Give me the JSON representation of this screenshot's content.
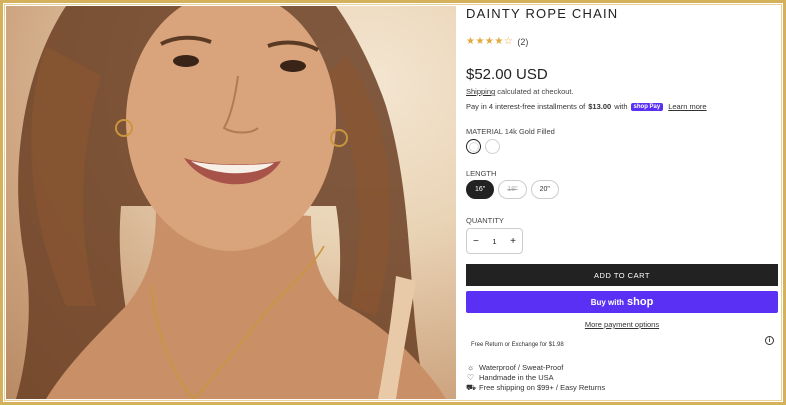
{
  "product": {
    "title": "DAINTY ROPE CHAIN",
    "stars": "★★★★☆",
    "review_count": "(2)",
    "rating": 4,
    "price": "$52.00 USD",
    "shipping_link": "Shipping",
    "shipping_text": "calculated at checkout.",
    "install_pre": "Pay in 4 interest-free installments of",
    "install_amount": "$13.00",
    "install_with": "with",
    "shoppay_badge": "shop Pay",
    "learn_more": "Learn more"
  },
  "material": {
    "label": "MATERIAL",
    "value": "14k Gold Filled"
  },
  "length": {
    "label": "LENGTH",
    "options": [
      "16\"",
      "18\"",
      "20\""
    ]
  },
  "quantity": {
    "label": "QUANTITY",
    "value": "1",
    "minus": "−",
    "plus": "+"
  },
  "actions": {
    "add_to_cart": "ADD TO CART",
    "buy_with": "Buy with",
    "shop": "shop",
    "more_payment": "More payment options"
  },
  "free_return": "Free Return or Exchange for $1.98",
  "info_icon": "i",
  "features": [
    {
      "icon": "sun-icon",
      "glyph": "☼",
      "text": "Waterproof / Sweat-Proof"
    },
    {
      "icon": "heart-icon",
      "glyph": "♡",
      "text": "Handmade in the USA"
    },
    {
      "icon": "truck-icon",
      "glyph": "⛟",
      "text": "Free shipping on $99+ / Easy Returns"
    }
  ],
  "colors": {
    "frame": "#d4b15a",
    "shop_pay": "#5a31f4",
    "cart_button": "#222222",
    "stars": "#e2a93b"
  }
}
